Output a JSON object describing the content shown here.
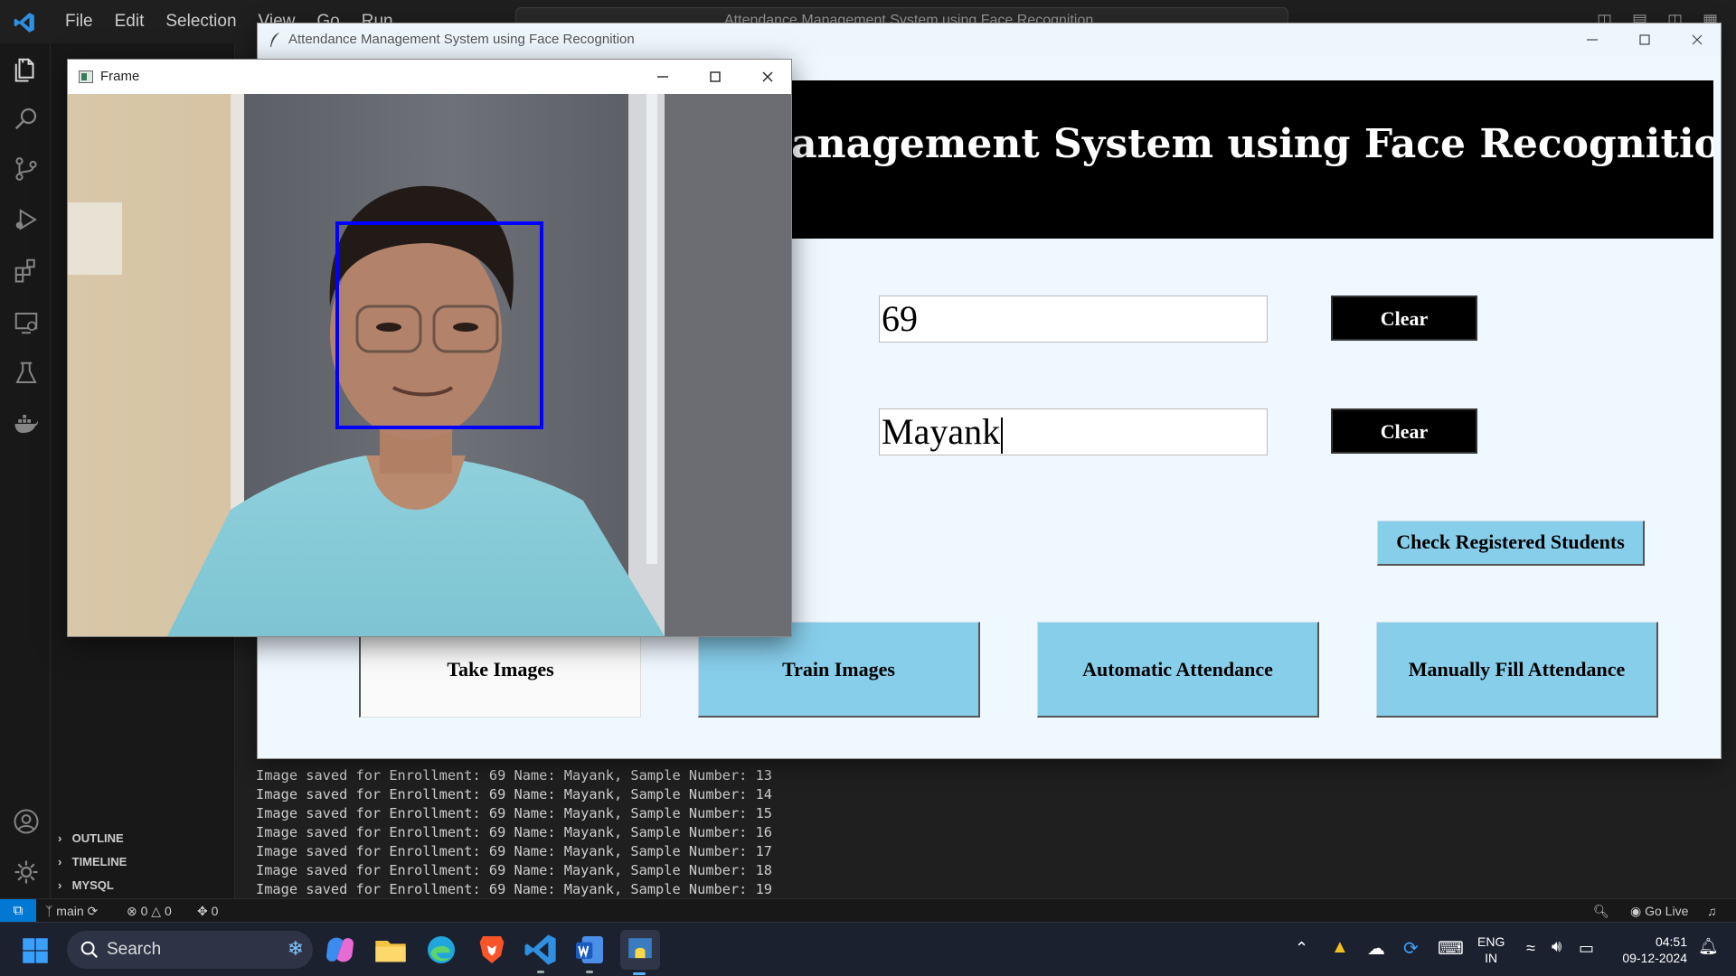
{
  "vscode": {
    "menu": [
      "File",
      "Edit",
      "Selection",
      "View",
      "Go",
      "Run",
      "…"
    ],
    "search_text": "Attendance Management System using Face Recognition",
    "sidebar_sections": [
      "OUTLINE",
      "TIMELINE",
      "MYSQL"
    ],
    "terminal_lines": [
      "Image saved for Enrollment: 69 Name: Mayank, Sample Number: 13",
      "Image saved for Enrollment: 69 Name: Mayank, Sample Number: 14",
      "Image saved for Enrollment: 69 Name: Mayank, Sample Number: 15",
      "Image saved for Enrollment: 69 Name: Mayank, Sample Number: 16",
      "Image saved for Enrollment: 69 Name: Mayank, Sample Number: 17",
      "Image saved for Enrollment: 69 Name: Mayank, Sample Number: 18",
      "Image saved for Enrollment: 69 Name: Mayank, Sample Number: 19"
    ],
    "status": {
      "branch": "main",
      "errors": "0",
      "warnings": "0",
      "ports": "0",
      "go_live": "Go Live"
    }
  },
  "tk_app": {
    "window_title": "Attendance Management System using Face Recognition",
    "banner_text": "Attendance Management System using Face Recognition",
    "enrollment_value": "69",
    "name_value": "Mayank",
    "clear_enrollment_label": "Clear",
    "clear_name_label": "Clear",
    "check_registered_label": "Check Registered Students",
    "take_images_label": "Take Images",
    "train_images_label": "Train Images",
    "automatic_attendance_label": "Automatic Attendance",
    "manual_attendance_label": "Manually Fill Attendance",
    "colors": {
      "banner_bg": "#000000",
      "button_blue": "#87ceeb",
      "window_bg": "#f0f8ff"
    }
  },
  "cv_frame": {
    "title": "Frame",
    "detection_box_color": "#0000ff"
  },
  "taskbar": {
    "search_label": "Search",
    "lang_top": "ENG",
    "lang_bottom": "IN",
    "time": "04:51",
    "date": "09-12-2024"
  }
}
